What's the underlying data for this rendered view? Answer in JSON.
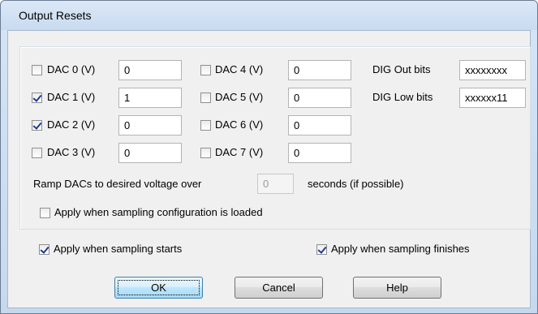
{
  "window": {
    "title": "Output Resets"
  },
  "dacs": [
    {
      "label": "DAC 0 (V)",
      "value": "0",
      "checked": false
    },
    {
      "label": "DAC 1 (V)",
      "value": "1",
      "checked": true
    },
    {
      "label": "DAC 2 (V)",
      "value": "0",
      "checked": true
    },
    {
      "label": "DAC 3 (V)",
      "value": "0",
      "checked": false
    },
    {
      "label": "DAC 4 (V)",
      "value": "0",
      "checked": false
    },
    {
      "label": "DAC 5 (V)",
      "value": "0",
      "checked": false
    },
    {
      "label": "DAC 6 (V)",
      "value": "0",
      "checked": false
    },
    {
      "label": "DAC 7 (V)",
      "value": "0",
      "checked": false
    }
  ],
  "dig": {
    "out_label": "DIG Out bits",
    "out_value": "xxxxxxxx",
    "low_label": "DIG Low bits",
    "low_value": "xxxxxx11"
  },
  "ramp": {
    "prefix": "Ramp DACs to desired voltage over",
    "value": "0",
    "suffix": "seconds (if possible)"
  },
  "options": {
    "config_loaded": {
      "label": "Apply when sampling configuration is loaded",
      "checked": false
    },
    "sampling_starts": {
      "label": "Apply when sampling starts",
      "checked": true
    },
    "sampling_finishes": {
      "label": "Apply when sampling finishes",
      "checked": true
    }
  },
  "buttons": {
    "ok": "OK",
    "cancel": "Cancel",
    "help": "Help"
  }
}
